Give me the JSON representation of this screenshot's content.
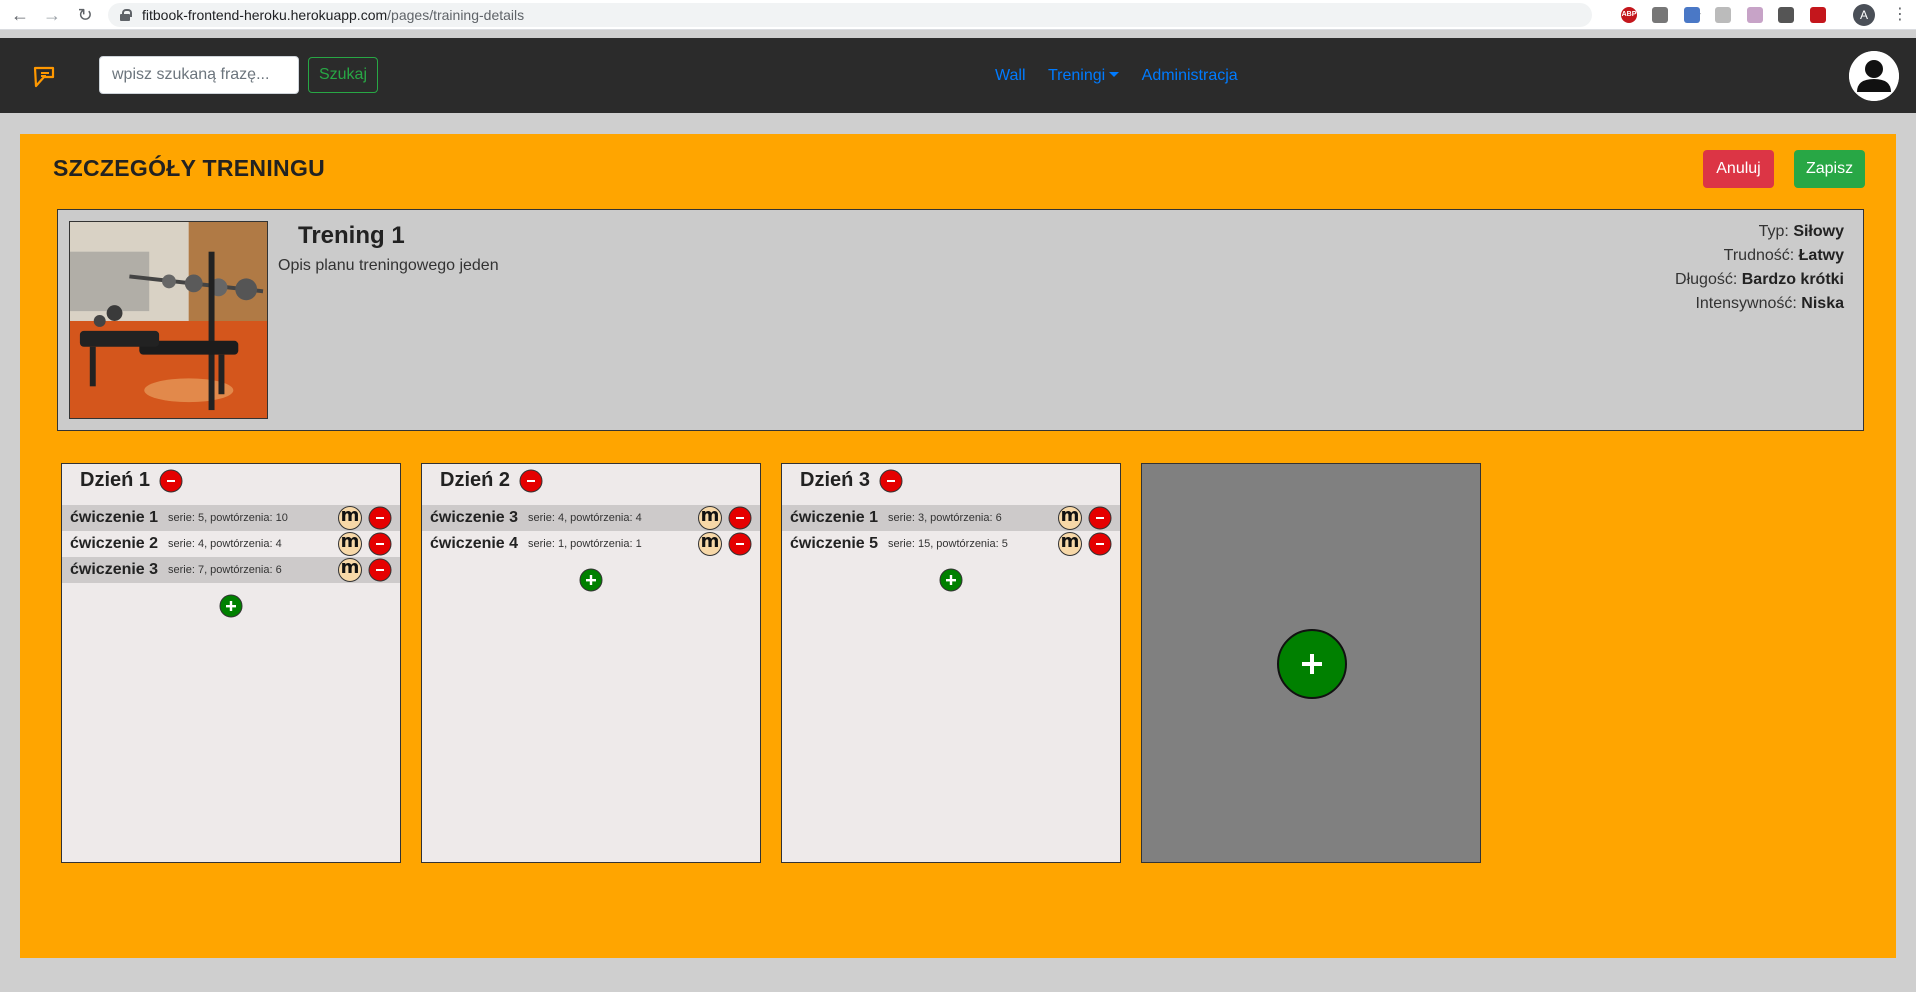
{
  "browser": {
    "url_host": "fitbook-frontend-heroku.herokuapp.com",
    "url_path": "/pages/training-details",
    "profile_initial": "A"
  },
  "navbar": {
    "search_placeholder": "wpisz szukaną frazę...",
    "search_button": "Szukaj",
    "links": {
      "wall": "Wall",
      "trainings": "Treningi",
      "admin": "Administracja"
    }
  },
  "page": {
    "title": "SZCZEGÓŁY TRENINGU",
    "cancel": "Anuluj",
    "save": "Zapisz"
  },
  "training": {
    "name": "Trening 1",
    "description": "Opis planu treningowego jeden",
    "type_label": "Typ:",
    "type_value": "Siłowy",
    "difficulty_label": "Trudność:",
    "difficulty_value": "Łatwy",
    "length_label": "Długość:",
    "length_value": "Bardzo krótki",
    "intensity_label": "Intensywność:",
    "intensity_value": "Niska"
  },
  "days": [
    {
      "title": "Dzień 1",
      "exercises": [
        {
          "name": "ćwiczenie 1",
          "info": "serie: 5, powtórzenia: 10",
          "m": "m"
        },
        {
          "name": "ćwiczenie 2",
          "info": "serie: 4, powtórzenia: 4",
          "m": "m"
        },
        {
          "name": "ćwiczenie 3",
          "info": "serie: 7, powtórzenia: 6",
          "m": "m"
        }
      ]
    },
    {
      "title": "Dzień 2",
      "exercises": [
        {
          "name": "ćwiczenie 3",
          "info": "serie: 4, powtórzenia: 4",
          "m": "m"
        },
        {
          "name": "ćwiczenie 4",
          "info": "serie: 1, powtórzenia: 1",
          "m": "m"
        }
      ]
    },
    {
      "title": "Dzień 3",
      "exercises": [
        {
          "name": "ćwiczenie 1",
          "info": "serie: 3, powtórzenia: 6",
          "m": "m"
        },
        {
          "name": "ćwiczenie 5",
          "info": "serie: 15, powtórzenia: 5",
          "m": "m"
        }
      ]
    }
  ],
  "colors": {
    "accent_orange": "#ffa500",
    "danger": "#dc3545",
    "success": "#28a745",
    "link": "#007bff",
    "remove_circle": "#e50000",
    "add_circle": "#008000"
  }
}
